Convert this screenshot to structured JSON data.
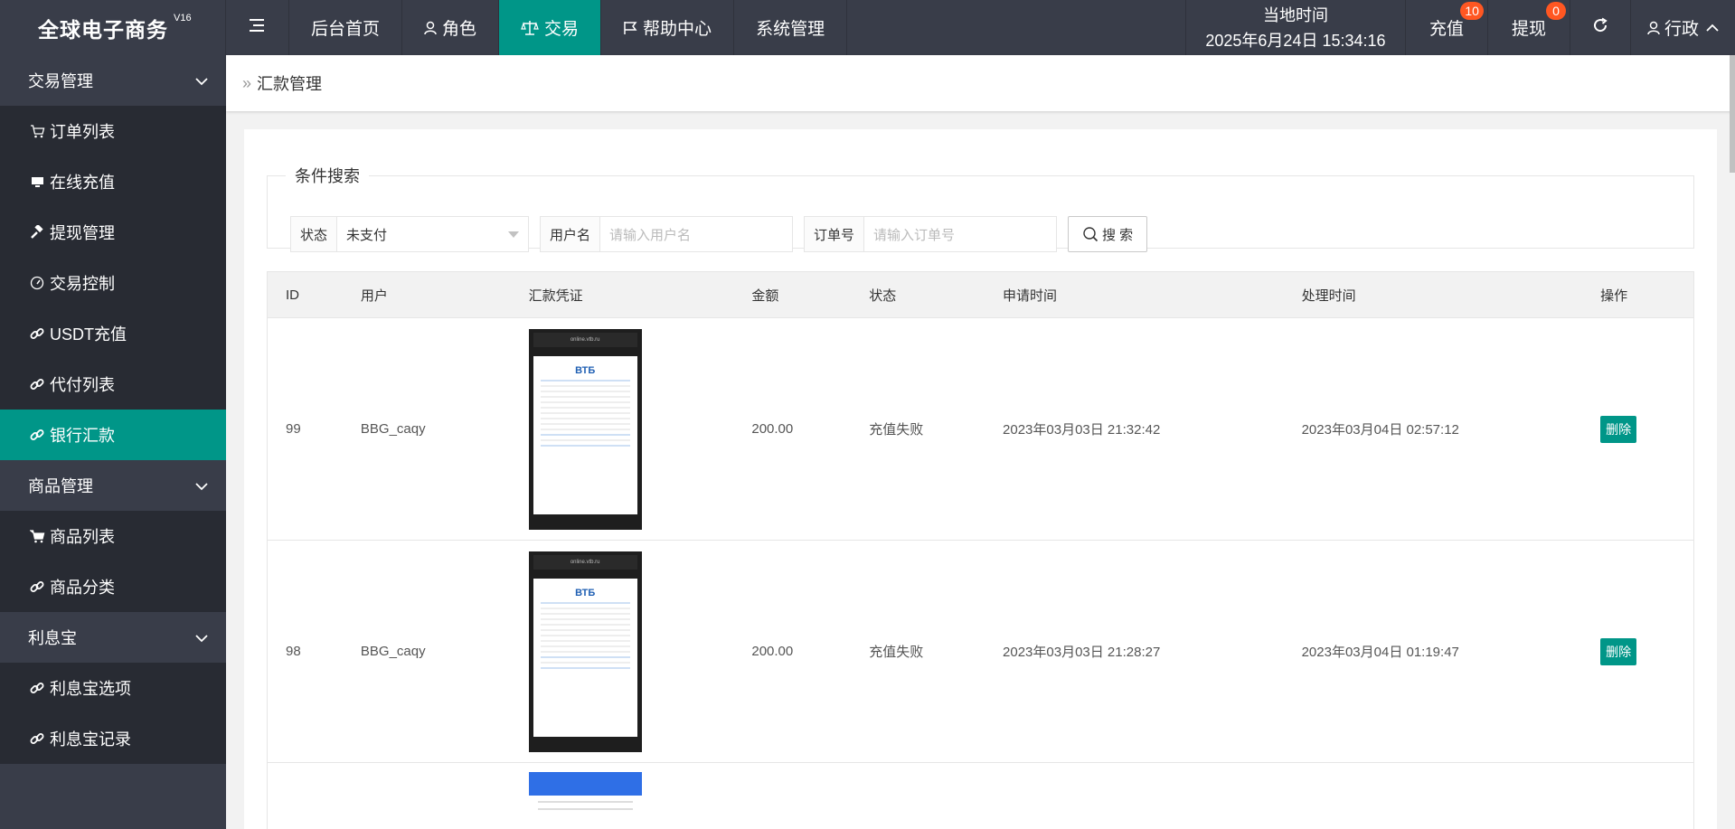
{
  "app": {
    "name": "全球电子商务",
    "version": "V16"
  },
  "nav": [
    {
      "label": "后台首页",
      "icon": "none",
      "active": false
    },
    {
      "label": "角色",
      "icon": "user-icon",
      "active": false
    },
    {
      "label": "交易",
      "icon": "scale-icon",
      "active": true
    },
    {
      "label": "帮助中心",
      "icon": "flag-icon",
      "active": false
    },
    {
      "label": "系统管理",
      "icon": "none",
      "active": false
    }
  ],
  "header_right": {
    "clock_label": "当地时间",
    "clock_value": "2025年6月24日 15:34:16",
    "recharge_label": "充值",
    "recharge_count": "10",
    "withdraw_label": "提现",
    "withdraw_count": "0",
    "user_label": "行政"
  },
  "sidebar": {
    "groups": [
      {
        "label": "交易管理",
        "items": [
          {
            "label": "订单列表",
            "icon": "cart-icon"
          },
          {
            "label": "在线充值",
            "icon": "screen-icon"
          },
          {
            "label": "提现管理",
            "icon": "gavel-icon"
          },
          {
            "label": "交易控制",
            "icon": "gauge-icon"
          },
          {
            "label": "USDT充值",
            "icon": "link-icon"
          },
          {
            "label": "代付列表",
            "icon": "link-icon"
          },
          {
            "label": "银行汇款",
            "icon": "link-icon",
            "active": true
          }
        ]
      },
      {
        "label": "商品管理",
        "items": [
          {
            "label": "商品列表",
            "icon": "cart-icon"
          },
          {
            "label": "商品分类",
            "icon": "link-icon"
          }
        ]
      },
      {
        "label": "利息宝",
        "items": [
          {
            "label": "利息宝选项",
            "icon": "link-icon"
          },
          {
            "label": "利息宝记录",
            "icon": "link-icon"
          }
        ]
      }
    ]
  },
  "breadcrumb": {
    "title": "汇款管理"
  },
  "search": {
    "legend": "条件搜索",
    "status_label": "状态",
    "status_value": "未支付",
    "username_label": "用户名",
    "username_placeholder": "请输入用户名",
    "order_label": "订单号",
    "order_placeholder": "请输入订单号",
    "button_label": "搜 索"
  },
  "table": {
    "columns": [
      "ID",
      "用户",
      "汇款凭证",
      "金额",
      "状态",
      "申请时间",
      "处理时间",
      "操作"
    ],
    "rows": [
      {
        "id": "99",
        "user": "BBG_caqy",
        "amount": "200.00",
        "status": "充值失败",
        "apply_time": "2023年03月03日 21:32:42",
        "process_time": "2023年03月04日 02:57:12",
        "action": "删除",
        "receipt_bank": "ВТБ"
      },
      {
        "id": "98",
        "user": "BBG_caqy",
        "amount": "200.00",
        "status": "充值失败",
        "apply_time": "2023年03月03日 21:28:27",
        "process_time": "2023年03月04日 01:19:47",
        "action": "删除",
        "receipt_bank": "ВТБ"
      }
    ]
  },
  "colors": {
    "accent": "#009688",
    "header_bg": "#393d49",
    "submenu_bg": "#282b33",
    "badge": "#ff5722"
  }
}
